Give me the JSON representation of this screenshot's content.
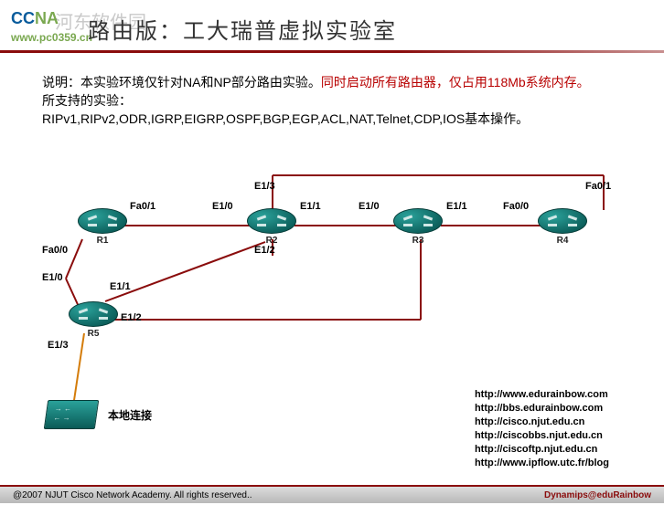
{
  "header": {
    "logo": "CCNA",
    "logo_sub": "www.pc0359.cn",
    "watermark": "河东软件园",
    "title": "路由版：工大瑞普虚拟实验室"
  },
  "description": {
    "line1_prefix": "说明：本实验环境仅针对NA和NP部分路由实验。",
    "line1_red": "同时启动所有路由器，仅占用118Mb系统内存。",
    "line2": "所支持的实验：",
    "line3": "RIPv1,RIPv2,ODR,IGRP,EIGRP,OSPF,BGP,EGP,ACL,NAT,Telnet,CDP,IOS基本操作。"
  },
  "routers": {
    "R1": "R1",
    "R2": "R2",
    "R3": "R3",
    "R4": "R4",
    "R5": "R5"
  },
  "switch_label": "本地连接",
  "ports": {
    "r1_fa01": "Fa0/1",
    "r1_fa00": "Fa0/0",
    "r1_e10": "E1/0",
    "r5_e11": "E1/1",
    "r5_e12": "E1/2",
    "r5_e13": "E1/3",
    "r2_e10": "E1/0",
    "r2_e11": "E1/1",
    "r2_e12": "E1/2",
    "r2_e13": "E1/3",
    "r3_e10": "E1/0",
    "r3_e11": "E1/1",
    "r4_fa00": "Fa0/0",
    "r4_fa01": "Fa0/1"
  },
  "urls": [
    "http://www.edurainbow.com",
    "http://bbs.edurainbow.com",
    "http://cisco.njut.edu.cn",
    "http://ciscobbs.njut.edu.cn",
    "http://ciscoftp.njut.edu.cn",
    "http://www.ipflow.utc.fr/blog"
  ],
  "footer": {
    "left": "@2007 NJUT Cisco Network Academy. All rights reserved..",
    "right": "Dynamips@eduRainbow"
  }
}
